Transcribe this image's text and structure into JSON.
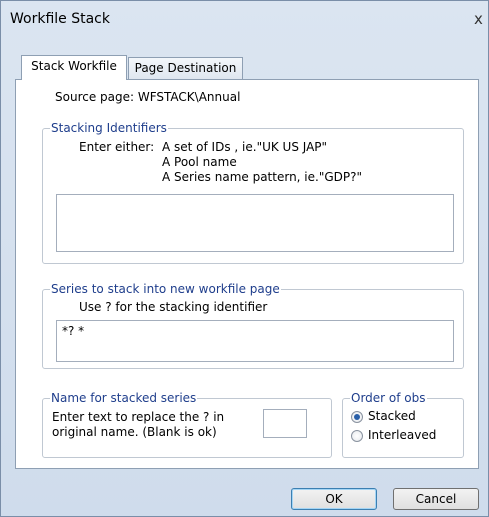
{
  "window": {
    "title": "Workfile Stack",
    "close_glyph": "x"
  },
  "tabs": [
    {
      "label": "Stack Workfile",
      "active": true
    },
    {
      "label": "Page Destination",
      "active": false
    }
  ],
  "source_page": "Source page: WFSTACK\\Annual",
  "stacking_identifiers": {
    "legend": "Stacking Identifiers",
    "enter_either": "Enter either:",
    "option1": "A set of IDs , ie.\"UK US JAP\"",
    "option2": "A Pool name",
    "option3": "A Series name pattern, ie.\"GDP?\"",
    "value": ""
  },
  "series_to_stack": {
    "legend": "Series to stack into new workfile page",
    "hint": "Use ? for the stacking identifier",
    "value": "*? *"
  },
  "name_for_stacked": {
    "legend": "Name for stacked series",
    "line1": "Enter text to replace the ? in",
    "line2": "original name. (Blank is ok)",
    "value": ""
  },
  "order_of_obs": {
    "legend": "Order of obs",
    "options": [
      {
        "label": "Stacked",
        "selected": true
      },
      {
        "label": "Interleaved",
        "selected": false
      }
    ]
  },
  "buttons": {
    "ok": "OK",
    "cancel": "Cancel"
  },
  "colors": {
    "legend_text": "#1f3e8c",
    "default_button_border": "#3c7fb1"
  }
}
